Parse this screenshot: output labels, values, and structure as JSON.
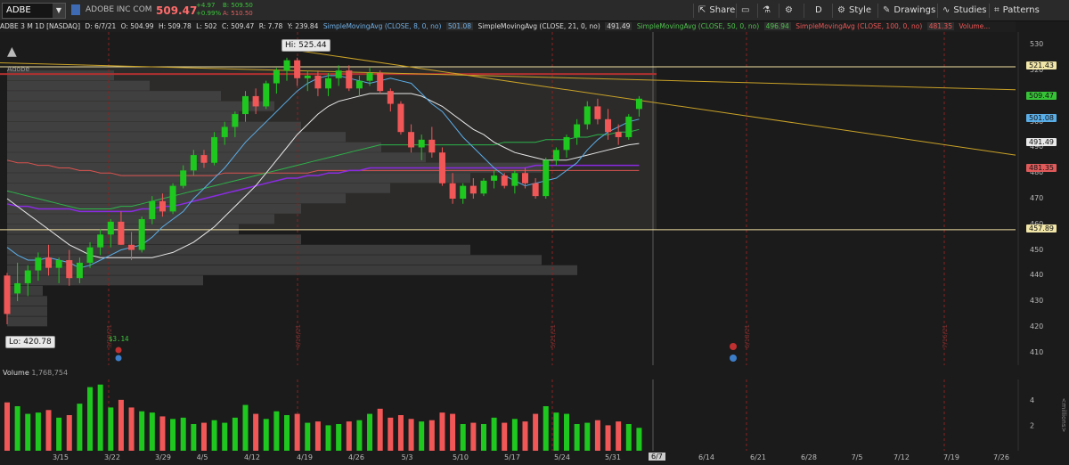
{
  "toolbar": {
    "symbol": "ADBE",
    "company": "ADOBE INC COM",
    "last": "509.47",
    "change": "+4.97",
    "change_pct": "+0.99%",
    "bid": "B: 509.50",
    "ask": "A: 510.50",
    "share": "Share",
    "aggregation": "D",
    "style": "Style",
    "drawings": "Drawings",
    "studies": "Studies",
    "patterns": "Patterns"
  },
  "study_header": {
    "title": "ADBE 3 M 1D [NASDAQ]",
    "date": "D: 6/7/21",
    "open": "O: 504.99",
    "high": "H: 509.78",
    "low": "L: 502",
    "close": "C: 509.47",
    "range": "R: 7.78",
    "y": "Y: 239.84",
    "sma8": "SimpleMovingAvg (CLOSE, 8, 0, no)",
    "sma8_val": "501.08",
    "sma21": "SimpleMovingAvg (CLOSE, 21, 0, no)",
    "sma21_val": "491.49",
    "sma50": "SimpleMovingAvg (CLOSE, 50, 0, no)",
    "sma50_val": "496.94",
    "sma100": "SimpleMovingAvg (CLOSE, 100, 0, no)",
    "sma100_val": "481.35",
    "volume_trunc": "Volume..."
  },
  "labels": {
    "lo": "Lo: 420.78",
    "hi": "Hi: 525.44",
    "adobe": "Adobe",
    "earnings": "$3.14",
    "volume_title": "Volume",
    "volume_value": "1,768,754",
    "millions": "<millions>",
    "current_date": "6/7"
  },
  "colors": {
    "up": "#1ec81e",
    "down": "#f25757",
    "sma8": "#5aaee8",
    "sma21": "#e8e8e8",
    "sma50": "#2db34a",
    "sma100": "#d9534f",
    "purple": "#8a2be2",
    "trendline": "#c9a227",
    "hline": "#f0e0a0"
  },
  "axis": {
    "price_ticks": [
      "530",
      "520",
      "510",
      "500",
      "490",
      "480",
      "470",
      "460",
      "450",
      "440",
      "430",
      "420",
      "410"
    ],
    "price_badges": [
      {
        "v": "521.43",
        "bg": "#f1e6a8"
      },
      {
        "v": "509.47",
        "bg": "#36c436"
      },
      {
        "v": "501.08",
        "bg": "#5aaee8"
      },
      {
        "v": "491.49",
        "bg": "#e8e8e8"
      },
      {
        "v": "481.35",
        "bg": "#e05a5a"
      },
      {
        "v": "457.89",
        "bg": "#f1e6a8"
      }
    ],
    "vol_ticks": [
      "4",
      "2"
    ],
    "x_ticks": [
      "3/15",
      "3/22",
      "3/29",
      "4/5",
      "4/12",
      "4/19",
      "4/26",
      "5/3",
      "5/10",
      "5/17",
      "5/24",
      "5/31",
      "6/14",
      "6/21",
      "6/28",
      "7/5",
      "7/12",
      "7/19",
      "7/26"
    ],
    "marker_dates": [
      "3/19/21",
      "4/16/21",
      "5/21/21",
      "6/18/21",
      "7/16/21"
    ]
  },
  "chart_data": {
    "type": "candlestick",
    "x": [
      "3/10",
      "3/11",
      "3/12",
      "3/15",
      "3/16",
      "3/17",
      "3/18",
      "3/19",
      "3/22",
      "3/23",
      "3/24",
      "3/25",
      "3/26",
      "3/29",
      "3/30",
      "3/31",
      "4/1",
      "4/5",
      "4/6",
      "4/7",
      "4/8",
      "4/9",
      "4/12",
      "4/13",
      "4/14",
      "4/15",
      "4/16",
      "4/19",
      "4/20",
      "4/21",
      "4/22",
      "4/23",
      "4/26",
      "4/27",
      "4/28",
      "4/29",
      "4/30",
      "5/3",
      "5/4",
      "5/5",
      "5/6",
      "5/7",
      "5/10",
      "5/11",
      "5/12",
      "5/13",
      "5/14",
      "5/17",
      "5/18",
      "5/19",
      "5/20",
      "5/21",
      "5/24",
      "5/25",
      "5/26",
      "5/27",
      "5/28",
      "6/1",
      "6/2",
      "6/3",
      "6/4",
      "6/7"
    ],
    "ohlc": [
      [
        440,
        441,
        421,
        425
      ],
      [
        433,
        445,
        430,
        437
      ],
      [
        437,
        444,
        432,
        442
      ],
      [
        442,
        449,
        438,
        447
      ],
      [
        447,
        452,
        440,
        443
      ],
      [
        443,
        447,
        437,
        446
      ],
      [
        446,
        450,
        436,
        439
      ],
      [
        439,
        447,
        437,
        445
      ],
      [
        445,
        453,
        443,
        451
      ],
      [
        451,
        458,
        448,
        456
      ],
      [
        456,
        462,
        451,
        461
      ],
      [
        461,
        465,
        452,
        452
      ],
      [
        452,
        457,
        446,
        450
      ],
      [
        450,
        463,
        449,
        462
      ],
      [
        462,
        471,
        460,
        469
      ],
      [
        469,
        472,
        463,
        465
      ],
      [
        465,
        476,
        464,
        475
      ],
      [
        475,
        483,
        474,
        481
      ],
      [
        481,
        489,
        479,
        487
      ],
      [
        487,
        489,
        482,
        484
      ],
      [
        484,
        496,
        483,
        494
      ],
      [
        494,
        500,
        491,
        498
      ],
      [
        498,
        504,
        494,
        503
      ],
      [
        503,
        512,
        500,
        510
      ],
      [
        510,
        513,
        503,
        506
      ],
      [
        506,
        516,
        505,
        515
      ],
      [
        515,
        521,
        511,
        520
      ],
      [
        520,
        525,
        516,
        524
      ],
      [
        524,
        525,
        514,
        517
      ],
      [
        517,
        520,
        512,
        518
      ],
      [
        518,
        520,
        510,
        513
      ],
      [
        513,
        519,
        510,
        517
      ],
      [
        517,
        522,
        514,
        520
      ],
      [
        520,
        522,
        512,
        513
      ],
      [
        513,
        518,
        510,
        516
      ],
      [
        516,
        521,
        514,
        519
      ],
      [
        519,
        520,
        511,
        512
      ],
      [
        512,
        513,
        504,
        507
      ],
      [
        507,
        508,
        495,
        496
      ],
      [
        496,
        499,
        488,
        490
      ],
      [
        490,
        495,
        485,
        493
      ],
      [
        493,
        498,
        486,
        488
      ],
      [
        488,
        490,
        475,
        476
      ],
      [
        476,
        480,
        468,
        470
      ],
      [
        470,
        476,
        468,
        475
      ],
      [
        475,
        478,
        470,
        472
      ],
      [
        472,
        478,
        471,
        477
      ],
      [
        477,
        481,
        474,
        479
      ],
      [
        479,
        480,
        474,
        475
      ],
      [
        475,
        481,
        472,
        480
      ],
      [
        480,
        482,
        474,
        476
      ],
      [
        476,
        478,
        470,
        471
      ],
      [
        471,
        486,
        470,
        485
      ],
      [
        485,
        490,
        483,
        489
      ],
      [
        489,
        495,
        486,
        494
      ],
      [
        494,
        501,
        491,
        499
      ],
      [
        499,
        508,
        497,
        506
      ],
      [
        506,
        509,
        499,
        501
      ],
      [
        501,
        505,
        493,
        496
      ],
      [
        496,
        499,
        491,
        494
      ],
      [
        494,
        503,
        493,
        502
      ],
      [
        505,
        510,
        502,
        509
      ]
    ],
    "volume_millions": [
      3.8,
      3.5,
      2.9,
      3.0,
      3.2,
      2.6,
      2.8,
      3.7,
      5.0,
      5.2,
      3.4,
      4.0,
      3.4,
      3.1,
      3.0,
      2.7,
      2.5,
      2.6,
      2.1,
      2.2,
      2.4,
      2.2,
      2.6,
      3.6,
      2.9,
      2.5,
      3.1,
      2.8,
      2.9,
      2.2,
      2.3,
      2.0,
      2.1,
      2.3,
      2.4,
      2.9,
      3.3,
      2.6,
      2.8,
      2.5,
      2.3,
      2.4,
      3.0,
      2.9,
      2.1,
      2.2,
      2.1,
      2.6,
      2.2,
      2.5,
      2.3,
      2.9,
      3.5,
      3.0,
      2.9,
      2.1,
      2.2,
      2.4,
      2.0,
      2.3,
      2.1,
      1.8
    ],
    "sma8": [
      451,
      448,
      446,
      446,
      447,
      446,
      445,
      443,
      444,
      446,
      448,
      450,
      451,
      452,
      455,
      459,
      462,
      465,
      470,
      474,
      478,
      482,
      487,
      492,
      496,
      500,
      504,
      508,
      512,
      515,
      517,
      518,
      518,
      517,
      516,
      515,
      516,
      517,
      516,
      515,
      511,
      507,
      504,
      499,
      494,
      490,
      486,
      482,
      479,
      477,
      475,
      476,
      477,
      478,
      481,
      484,
      489,
      493,
      496,
      498,
      500,
      501
    ],
    "sma21": [
      470,
      467,
      464,
      461,
      458,
      455,
      452,
      450,
      448,
      447,
      447,
      447,
      447,
      447,
      447,
      448,
      449,
      451,
      453,
      456,
      459,
      463,
      467,
      471,
      475,
      480,
      485,
      490,
      495,
      499,
      503,
      506,
      508,
      509,
      510,
      511,
      511,
      511,
      511,
      511,
      510,
      508,
      506,
      503,
      500,
      497,
      495,
      492,
      490,
      488,
      487,
      486,
      485,
      485,
      485,
      486,
      487,
      488,
      489,
      490,
      491,
      491.5
    ],
    "sma50": [
      473,
      472,
      471,
      470,
      469,
      468,
      467,
      466,
      466,
      466,
      466,
      467,
      467,
      468,
      469,
      470,
      471,
      472,
      473,
      474,
      475,
      476,
      477,
      478,
      479,
      480,
      481,
      482,
      483,
      484,
      485,
      486,
      487,
      488,
      489,
      490,
      491,
      491,
      491,
      491,
      491,
      491,
      491,
      491,
      491,
      491,
      491,
      491,
      492,
      492,
      492,
      492,
      493,
      493,
      493,
      494,
      494,
      495,
      495,
      496,
      496,
      497
    ],
    "sma100": [
      485,
      484,
      484,
      483,
      483,
      482,
      482,
      481,
      481,
      480,
      480,
      479,
      479,
      479,
      479,
      479,
      479,
      479,
      479,
      479,
      479,
      480,
      480,
      480,
      480,
      480,
      480,
      480,
      480,
      480,
      481,
      481,
      481,
      481,
      481,
      481,
      481,
      481,
      481,
      481,
      481,
      481,
      481,
      481,
      481,
      481,
      481,
      481,
      481,
      481,
      481,
      481,
      481,
      481,
      481,
      481,
      481,
      481,
      481,
      481,
      481,
      481
    ],
    "purple": [
      468,
      467,
      467,
      466,
      466,
      466,
      466,
      465,
      465,
      465,
      465,
      465,
      465,
      466,
      466,
      467,
      467,
      468,
      469,
      470,
      471,
      472,
      473,
      474,
      475,
      476,
      477,
      478,
      478,
      479,
      479,
      480,
      480,
      481,
      481,
      482,
      482,
      482,
      482,
      482,
      482,
      482,
      482,
      482,
      482,
      482,
      482,
      482,
      482,
      482,
      482,
      483,
      483,
      483,
      483,
      483,
      483,
      483,
      483,
      483,
      483,
      483
    ],
    "hlines": [
      521.43,
      457.89
    ],
    "lo": 420.78,
    "hi": 525.44,
    "ylim": [
      405,
      535
    ]
  }
}
